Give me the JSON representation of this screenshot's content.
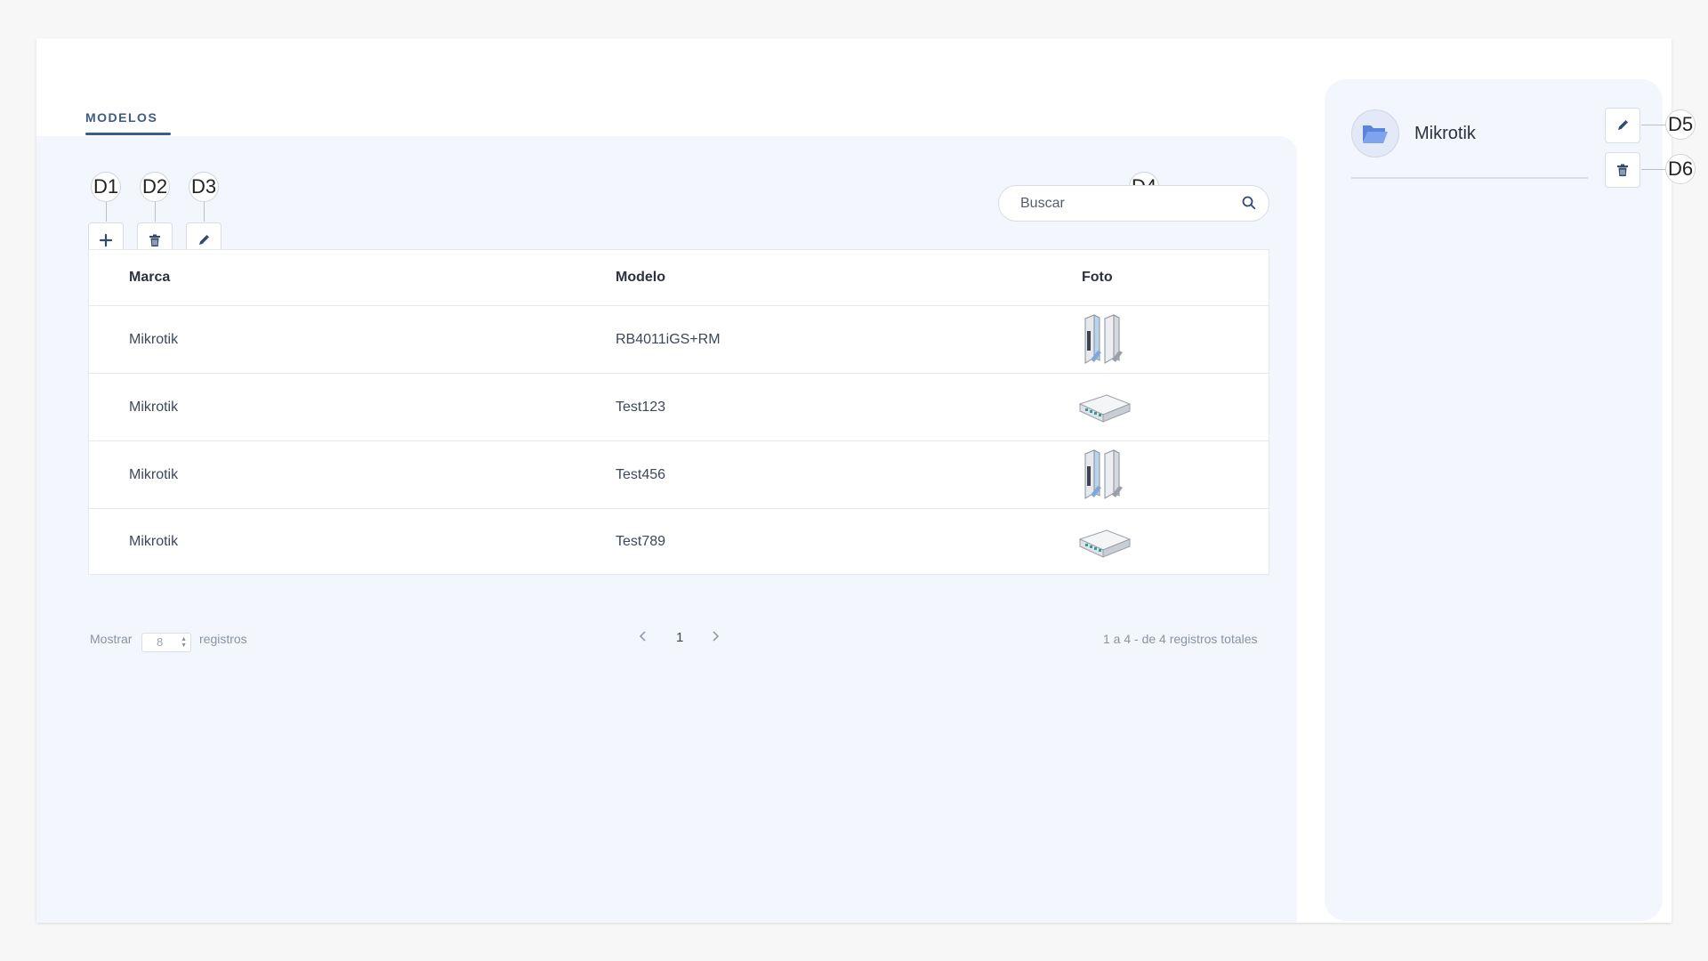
{
  "tabs": {
    "active_label": "MODELOS"
  },
  "toolbar": {
    "add_icon": "plus-icon",
    "delete_icon": "trash-icon",
    "edit_icon": "pencil-icon"
  },
  "callouts": {
    "d1": "D1",
    "d2": "D2",
    "d3": "D3",
    "d4": "D4",
    "d5": "D5",
    "d6": "D6"
  },
  "search": {
    "placeholder": "Buscar",
    "value": "",
    "icon": "search-icon"
  },
  "table": {
    "columns": [
      "Marca",
      "Modelo",
      "Foto"
    ],
    "rows": [
      {
        "marca": "Mikrotik",
        "modelo": "RB4011iGS+RM",
        "foto": "router-tower-image"
      },
      {
        "marca": "Mikrotik",
        "modelo": "Test123",
        "foto": "router-flat-image"
      },
      {
        "marca": "Mikrotik",
        "modelo": "Test456",
        "foto": "router-tower-image"
      },
      {
        "marca": "Mikrotik",
        "modelo": "Test789",
        "foto": "router-flat-image"
      }
    ]
  },
  "pagination": {
    "show_label": "Mostrar",
    "page_size": "8",
    "records_label": "registros",
    "current_page": "1",
    "summary": "1 a 4 - de 4 registros totales"
  },
  "side_panel": {
    "brand_name": "Mikrotik",
    "avatar_icon": "folder-open-icon",
    "edit_icon": "pencil-icon",
    "delete_icon": "trash-icon"
  },
  "colors": {
    "accent": "#3e5a86",
    "panel_bg": "#f3f6fc",
    "folder_blue": "#6d93e6"
  }
}
